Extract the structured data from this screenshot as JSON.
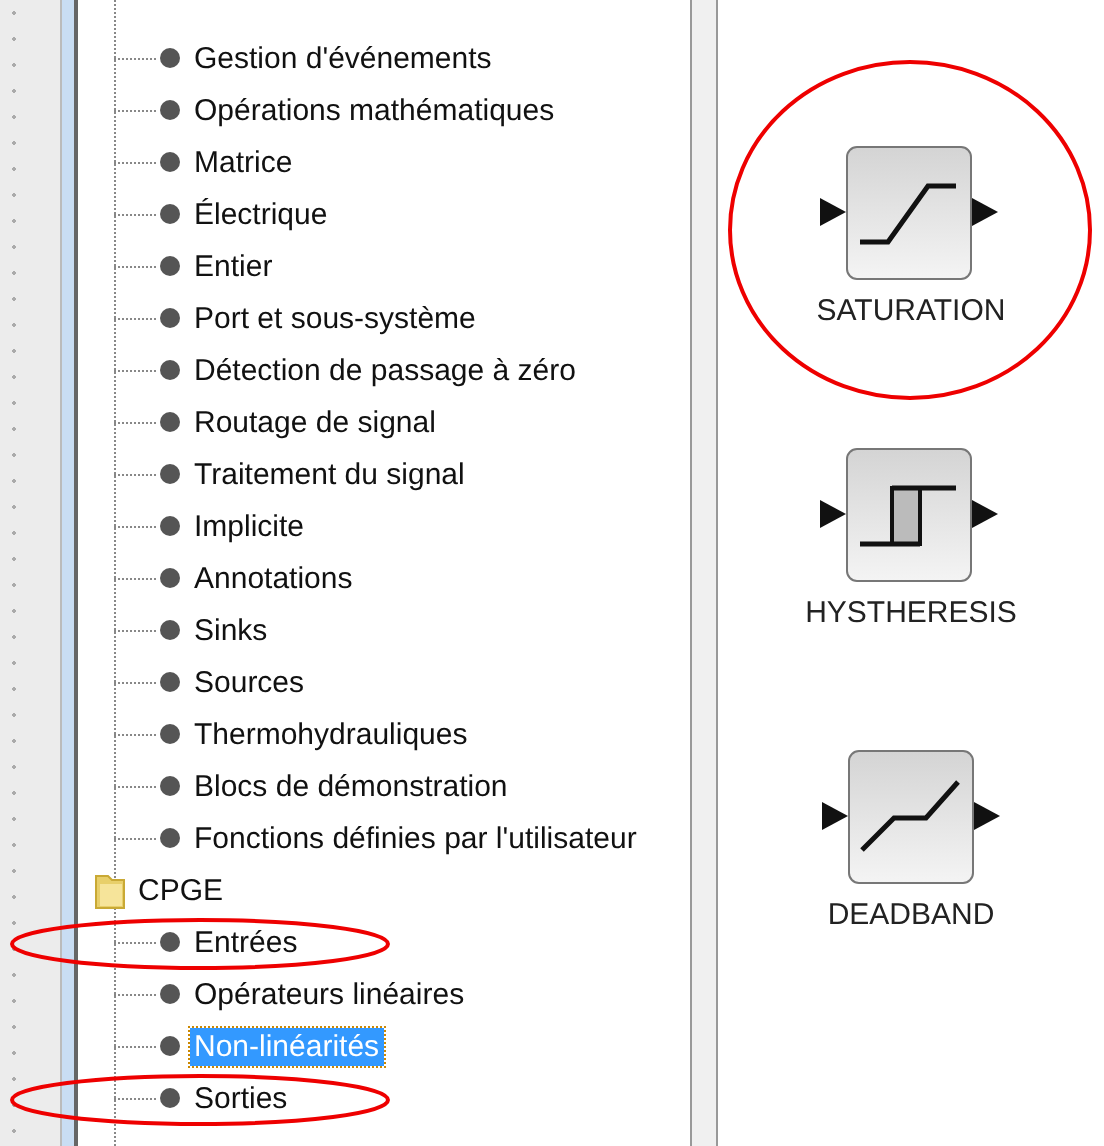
{
  "tree": [
    {
      "kind": "leaf",
      "label": "Gestion d'événements",
      "selected": false,
      "circled": false
    },
    {
      "kind": "leaf",
      "label": "Opérations mathématiques",
      "selected": false,
      "circled": false
    },
    {
      "kind": "leaf",
      "label": "Matrice",
      "selected": false,
      "circled": false
    },
    {
      "kind": "leaf",
      "label": "Électrique",
      "selected": false,
      "circled": false
    },
    {
      "kind": "leaf",
      "label": "Entier",
      "selected": false,
      "circled": false
    },
    {
      "kind": "leaf",
      "label": "Port et sous-système",
      "selected": false,
      "circled": false
    },
    {
      "kind": "leaf",
      "label": "Détection de passage à zéro",
      "selected": false,
      "circled": false
    },
    {
      "kind": "leaf",
      "label": "Routage de signal",
      "selected": false,
      "circled": false
    },
    {
      "kind": "leaf",
      "label": "Traitement du signal",
      "selected": false,
      "circled": false
    },
    {
      "kind": "leaf",
      "label": "Implicite",
      "selected": false,
      "circled": false
    },
    {
      "kind": "leaf",
      "label": "Annotations",
      "selected": false,
      "circled": false
    },
    {
      "kind": "leaf",
      "label": "Sinks",
      "selected": false,
      "circled": false
    },
    {
      "kind": "leaf",
      "label": "Sources",
      "selected": false,
      "circled": false
    },
    {
      "kind": "leaf",
      "label": "Thermohydrauliques",
      "selected": false,
      "circled": false
    },
    {
      "kind": "leaf",
      "label": "Blocs de démonstration",
      "selected": false,
      "circled": false
    },
    {
      "kind": "leaf",
      "label": "Fonctions définies par l'utilisateur",
      "selected": false,
      "circled": false
    },
    {
      "kind": "folder",
      "label": "CPGE",
      "selected": false,
      "circled": false,
      "children": [
        {
          "kind": "leaf",
          "label": "Entrées",
          "selected": false,
          "circled": true
        },
        {
          "kind": "leaf",
          "label": "Opérateurs linéaires",
          "selected": false,
          "circled": false
        },
        {
          "kind": "leaf",
          "label": "Non-linéarités",
          "selected": true,
          "circled": false
        },
        {
          "kind": "leaf",
          "label": "Sorties",
          "selected": false,
          "circled": true
        }
      ]
    }
  ],
  "blocks": [
    {
      "kind": "saturation",
      "label": "SATURATION",
      "circled": true
    },
    {
      "kind": "hysteresis",
      "label": "HYSTHERESIS",
      "circled": false
    },
    {
      "kind": "deadband",
      "label": "DEADBAND",
      "circled": false
    }
  ]
}
